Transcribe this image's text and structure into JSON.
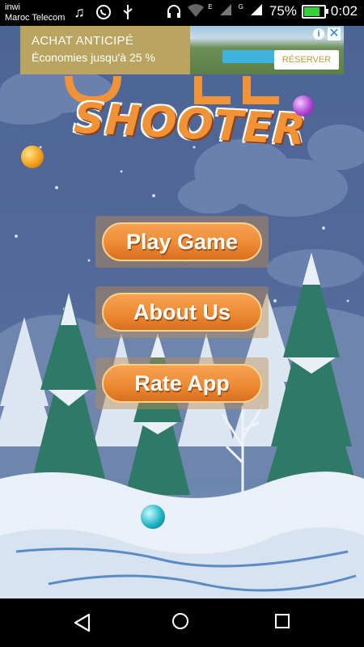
{
  "status_bar": {
    "carrier_1": "inwi",
    "carrier_2": "Maroc Telecom",
    "network_1": "E",
    "network_2": "G",
    "battery_percent": "75%",
    "battery_level": 0.75,
    "time": "0:02",
    "icons": [
      "music-note-icon",
      "whatsapp-icon",
      "usb-icon",
      "headset-icon",
      "wifi-icon",
      "signal-icon",
      "signal-icon",
      "battery-charging-icon"
    ]
  },
  "ad": {
    "title": "ACHAT ANTICIPÉ",
    "subtitle": "Économies jusqu'à 25 %",
    "cta": "RÉSERVER",
    "info_label": "i",
    "close_label": "✕",
    "left_color": "#b9a55f"
  },
  "logo": {
    "line_2": "SHOOTER"
  },
  "menu": {
    "play_label": "Play Game",
    "about_label": "About Us",
    "rate_label": "Rate App"
  },
  "colors": {
    "button_orange": "#ef8a34",
    "sky": "#4d6496"
  }
}
